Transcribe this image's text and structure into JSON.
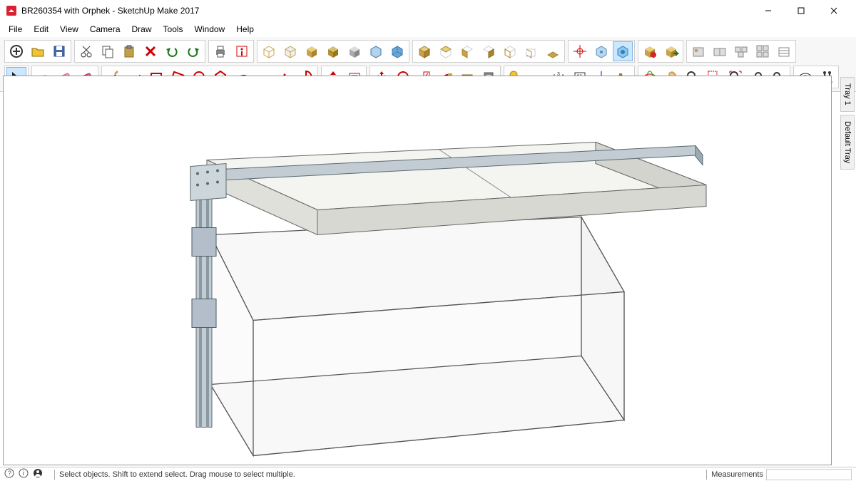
{
  "window": {
    "title": "BR260354 with Orphek - SketchUp Make 2017",
    "controls": {
      "min": "–",
      "max": "▢",
      "close": "✕"
    }
  },
  "menu": [
    "File",
    "Edit",
    "View",
    "Camera",
    "Draw",
    "Tools",
    "Window",
    "Help"
  ],
  "status": {
    "hint": "Select objects. Shift to extend select. Drag mouse to select multiple.",
    "measurements_label": "Measurements"
  },
  "trays": [
    "Tray 1",
    "Default Tray"
  ],
  "toolbars": {
    "row1": [
      {
        "group": "file",
        "tools": [
          "new-file",
          "open-file",
          "save-file"
        ]
      },
      {
        "group": "edit",
        "tools": [
          "cut",
          "copy",
          "paste",
          "delete",
          "undo",
          "redo"
        ]
      },
      {
        "group": "print",
        "tools": [
          "print",
          "model-info"
        ]
      },
      {
        "group": "display",
        "tools": [
          "wireframe",
          "hidden-line",
          "shaded",
          "shaded-textures",
          "monochrome",
          "xray",
          "back-edges"
        ]
      },
      {
        "group": "views",
        "tools": [
          "iso-view",
          "top-view",
          "front-view",
          "right-view",
          "back-view",
          "left-view",
          "bottom-view"
        ]
      },
      {
        "group": "axes",
        "tools": [
          "axes-tool",
          "position-camera",
          "walk-tool"
        ]
      },
      {
        "group": "warehouse",
        "tools": [
          "3d-warehouse",
          "share-model"
        ]
      },
      {
        "group": "components",
        "tools": [
          "extension-warehouse",
          "make-component",
          "make-group",
          "explode",
          "outliner"
        ]
      }
    ],
    "row2": [
      {
        "group": "select",
        "tools": [
          "select-tool"
        ]
      },
      {
        "group": "modify",
        "tools": [
          "eraser-small",
          "eraser-large",
          "eraser-fill"
        ]
      },
      {
        "group": "draw",
        "tools": [
          "line-tool",
          "freehand-tool",
          "rectangle-tool",
          "rotated-rect-tool",
          "circle-tool",
          "polygon-tool",
          "arc-tool",
          "2pt-arc-tool",
          "3pt-arc-tool",
          "pie-tool"
        ]
      },
      {
        "group": "sandbox",
        "tools": [
          "pushpull-tool",
          "offset-tool"
        ]
      },
      {
        "group": "move",
        "tools": [
          "move-tool",
          "rotate-tool",
          "scale-tool",
          "follow-me-tool",
          "tape-tool",
          "section-tool"
        ]
      },
      {
        "group": "measure",
        "tools": [
          "tape-measure",
          "protractor",
          "dimension-tool",
          "text-tool",
          "axes-small",
          "3d-text"
        ]
      },
      {
        "group": "camera",
        "tools": [
          "orbit-tool",
          "pan-tool",
          "zoom-tool",
          "zoom-window",
          "zoom-extents",
          "previous-view",
          "next-view"
        ]
      },
      {
        "group": "misc",
        "tools": [
          "look-around",
          "walk"
        ]
      }
    ]
  },
  "active_tool": "select-tool"
}
